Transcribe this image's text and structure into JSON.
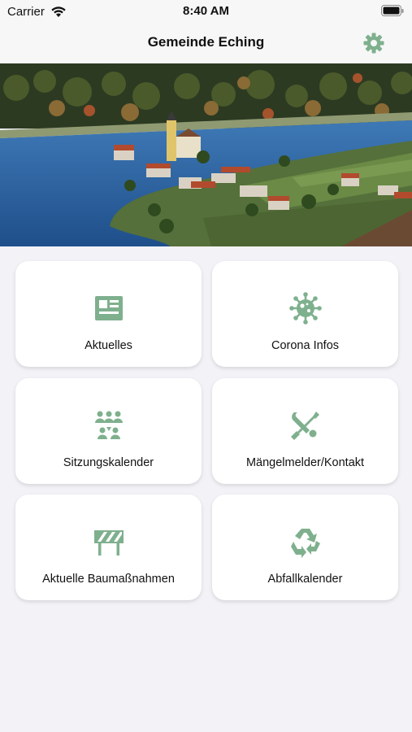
{
  "status_bar": {
    "carrier": "Carrier",
    "time": "8:40 AM"
  },
  "nav": {
    "title": "Gemeinde Eching",
    "settings_icon": "gear-icon"
  },
  "hero": {
    "description_icon": "village-aerial-photo"
  },
  "accent_color": "#7fb08e",
  "tiles": [
    {
      "label": "Aktuelles",
      "icon": "news-icon"
    },
    {
      "label": "Corona Infos",
      "icon": "virus-icon"
    },
    {
      "label": "Sitzungskalender",
      "icon": "meeting-icon"
    },
    {
      "label": "Mängelmelder/Kontakt",
      "icon": "tools-icon"
    },
    {
      "label": "Aktuelle Baumaßnahmen",
      "icon": "construction-barrier-icon"
    },
    {
      "label": "Abfallkalender",
      "icon": "recycle-icon"
    }
  ]
}
